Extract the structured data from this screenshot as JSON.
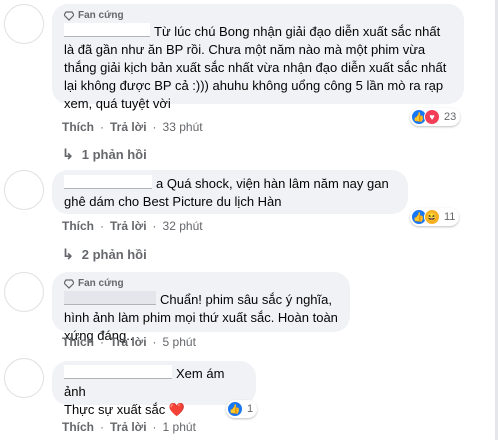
{
  "comments": [
    {
      "badge": "Fan cứng",
      "text": "Từ lúc chú Bong nhận giải đạo diễn xuất sắc nhất là đã gần như ăn BP rồi. Chưa một năm nào mà một phim vừa thắng giải kịch bản xuất sắc nhất vừa nhận đạo diễn xuất sắc nhất lại không được BP cả :))) ahuhu không uổng công 5 lần mò ra rạp xem, quá tuyệt vời",
      "like": "Thích",
      "reply": "Trả lời",
      "time": "33 phút",
      "reaction_count": "23",
      "replies_label": "1 phản hồi"
    },
    {
      "name_fragment": "a",
      "text": "Quá shock, viện hàn lâm năm nay gan ghê dám cho Best Picture du lịch Hàn",
      "like": "Thích",
      "reply": "Trả lời",
      "time": "32 phút",
      "reaction_count": "11",
      "replies_label": "2 phản hồi"
    },
    {
      "badge": "Fan cứng",
      "text": "Chuẩn! phim sâu sắc ý nghĩa, hình ảnh làm phim mọi thứ xuất sắc. Hoàn toàn xứng đáng..",
      "like": "Thích",
      "reply": "Trả lời",
      "time": "5 phút"
    },
    {
      "text_line1": "Xem ám ảnh",
      "text_line2": "Thực sự xuất sắc",
      "like": "Thích",
      "reply": "Trả lời",
      "time": "1 phút",
      "reaction_count": "1"
    }
  ],
  "colors": {
    "like": "#1877f2",
    "love": "#f33e58",
    "haha": "#f7b125",
    "bubble": "#f0f2f5",
    "meta": "#65676b"
  }
}
